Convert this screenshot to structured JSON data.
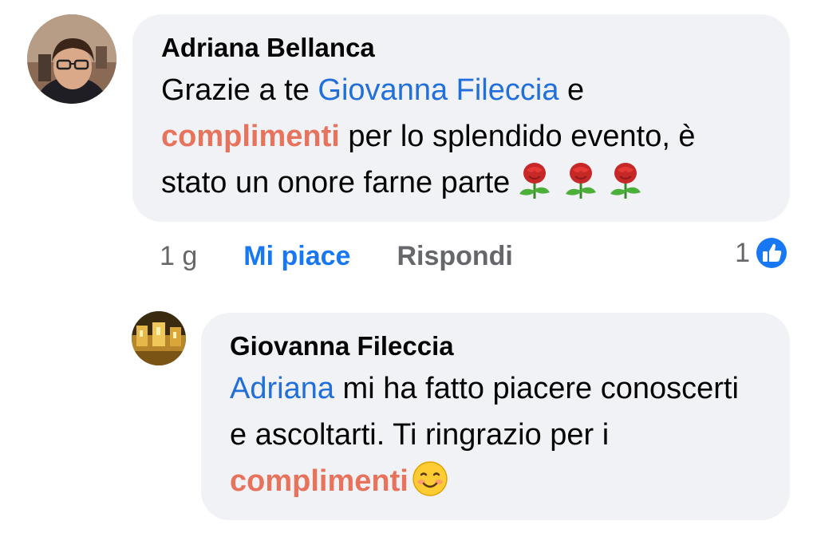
{
  "comment": {
    "author": "Adriana Bellanca",
    "text_1": "Grazie a te ",
    "mention": "Giovanna Fileccia",
    "text_2": " e",
    "highlight": "complimenti",
    "text_3": " per lo splendido evento, è stato un onore farne parte",
    "emoji": "rose-icon x3",
    "time": "1 g",
    "like_label": "Mi piace",
    "reply_label": "Rispondi",
    "reaction_count": "1",
    "reaction_icon": "thumbs-up-icon"
  },
  "reply": {
    "author": "Giovanna Fileccia",
    "mention": "Adriana",
    "text_1": " mi ha fatto piacere conoscerti e ascoltarti. Ti ringrazio per i ",
    "highlight": "complimenti",
    "emoji": "smiling-face-icon"
  },
  "colors": {
    "mention": "#216fdb",
    "highlight": "#e8735c",
    "bubble": "#f0f2f5",
    "like_action": "#1877f2",
    "meta_text": "#65676b"
  }
}
